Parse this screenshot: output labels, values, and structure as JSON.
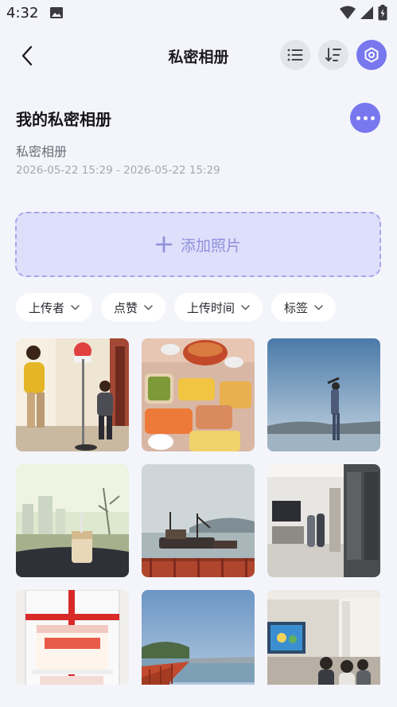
{
  "status_bar": {
    "time": "4:32"
  },
  "header": {
    "title": "私密相册"
  },
  "album": {
    "name": "我的私密相册",
    "description": "私密相册",
    "date_range": "2026-05-22 15:29 - 2026-05-22 15:29"
  },
  "add_photo": {
    "label": "添加照片"
  },
  "filters": [
    {
      "label": "上传者"
    },
    {
      "label": "点赞"
    },
    {
      "label": "上传时间"
    },
    {
      "label": "标签"
    }
  ],
  "photos": [
    {
      "subject": "child-with-basketball-hoop"
    },
    {
      "subject": "dinner-table-food"
    },
    {
      "subject": "person-at-seaside"
    },
    {
      "subject": "coffee-on-car-dashboard"
    },
    {
      "subject": "fishing-boats-harbor"
    },
    {
      "subject": "modern-living-room"
    },
    {
      "subject": "birthday-cake"
    },
    {
      "subject": "coastal-walkway"
    },
    {
      "subject": "family-watching-tv"
    }
  ],
  "colors": {
    "accent": "#7877ee",
    "background": "#f4f5fb",
    "add_photo_bg": "#dedffa"
  }
}
